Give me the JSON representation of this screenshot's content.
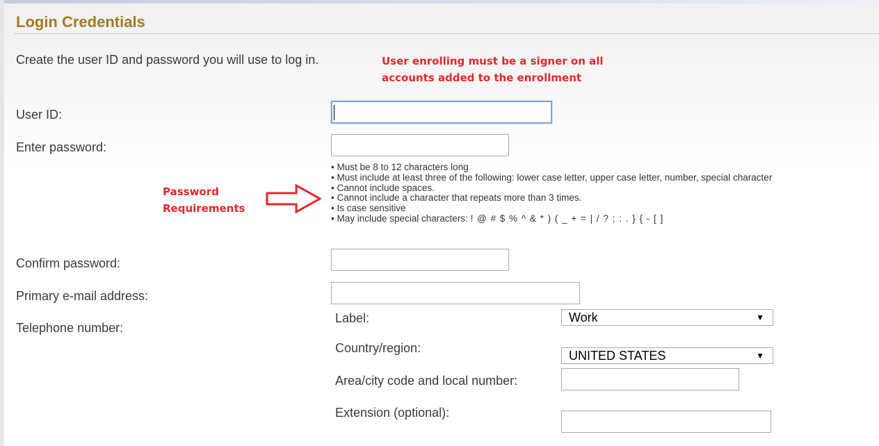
{
  "section": {
    "title": "Login Credentials",
    "intro": "Create the user ID and password you will use to log in.",
    "notice": "User enrolling must be a signer on all accounts added to the enrollment"
  },
  "fields": {
    "user_id_label": "User ID:",
    "user_id_value": "",
    "password_label": "Enter password:",
    "password_value": "",
    "confirm_password_label": "Confirm password:",
    "confirm_password_value": "",
    "email_label": "Primary e-mail address:",
    "email_value": "",
    "telephone_label": "Telephone number:"
  },
  "password_requirements": [
    "• Must be 8 to 12 characters long",
    "• Must include at least three of the following: lower case letter, upper case letter, number, special character",
    "• Cannot include spaces.",
    "• Cannot include a character that repeats more than 3 times.",
    "• Is case sensitive"
  ],
  "special_chars": {
    "prefix": "• May include special characters:",
    "chars": "! @ # $ % ^ & * ) ( _ + = | / ? ; : . } { - [ ]"
  },
  "callout": {
    "line1": "Password",
    "line2": "Requirements",
    "color": "#e8262c",
    "icon": "right-arrow-outline-icon"
  },
  "telephone": {
    "label_label": "Label:",
    "label_selected": "Work",
    "country_label": "Country/region:",
    "country_selected": "UNITED STATES",
    "area_label": "Area/city code and local number:",
    "area_value": "",
    "extension_label": "Extension (optional):",
    "extension_value": ""
  },
  "colors": {
    "title": "#a27b22",
    "notice": "#e8262c",
    "focus_border": "#7ba7d8"
  }
}
